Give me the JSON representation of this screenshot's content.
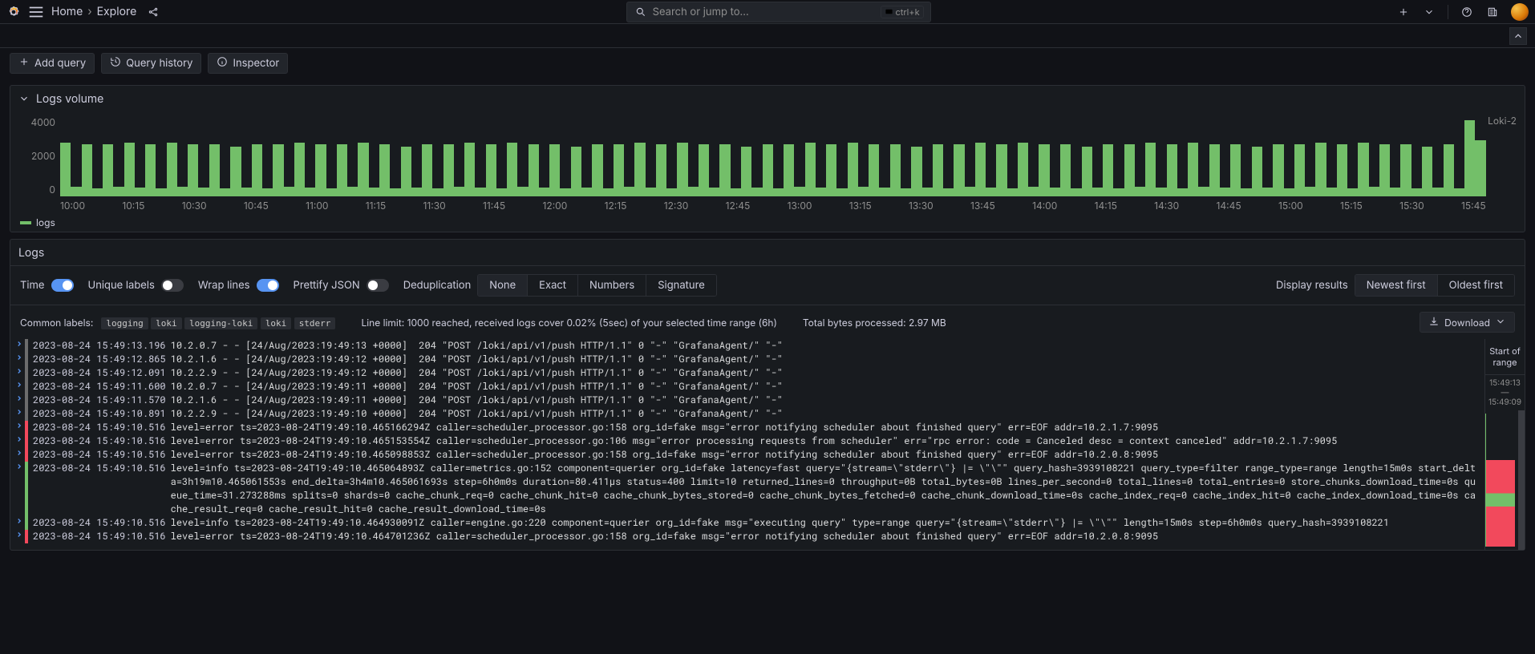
{
  "nav": {
    "home": "Home",
    "explore": "Explore",
    "search_placeholder": "Search or jump to...",
    "shortcut_hint": "ctrl+k"
  },
  "toolbar": {
    "add_query": "Add query",
    "query_history": "Query history",
    "inspector": "Inspector"
  },
  "logs_volume": {
    "title": "Logs volume",
    "legend_series": "Loki-2",
    "legend_label": "logs"
  },
  "logs_panel_title": "Logs",
  "controls": {
    "time_label": "Time",
    "unique_label": "Unique labels",
    "wrap_label": "Wrap lines",
    "prettify_label": "Prettify JSON",
    "dedup_label": "Deduplication",
    "dedup_options": [
      "None",
      "Exact",
      "Numbers",
      "Signature"
    ],
    "display_label": "Display results",
    "order_options": [
      "Newest first",
      "Oldest first"
    ]
  },
  "meta": {
    "common_labels_label": "Common labels:",
    "common_labels": [
      "logging",
      "loki",
      "logging-loki",
      "loki",
      "stderr"
    ],
    "line_limit": "Line limit: 1000 reached, received logs cover 0.02% (5sec) of your selected time range (6h)",
    "bytes": "Total bytes processed: 2.97 MB",
    "download": "Download"
  },
  "minimap": {
    "start": "Start of range",
    "t_top": "15:49:13",
    "t_mid": "—",
    "t_bot": "15:49:09"
  },
  "log_lines": [
    {
      "lvl": "none",
      "ts": "2023-08-24 15:49:13.196",
      "msg": "10.2.0.7 - - [24/Aug/2023:19:49:13 +0000]  204 \"POST /loki/api/v1/push HTTP/1.1\" 0 \"-\" \"GrafanaAgent/\" \"-\""
    },
    {
      "lvl": "none",
      "ts": "2023-08-24 15:49:12.865",
      "msg": "10.2.1.6 - - [24/Aug/2023:19:49:12 +0000]  204 \"POST /loki/api/v1/push HTTP/1.1\" 0 \"-\" \"GrafanaAgent/\" \"-\""
    },
    {
      "lvl": "none",
      "ts": "2023-08-24 15:49:12.091",
      "msg": "10.2.2.9 - - [24/Aug/2023:19:49:12 +0000]  204 \"POST /loki/api/v1/push HTTP/1.1\" 0 \"-\" \"GrafanaAgent/\" \"-\""
    },
    {
      "lvl": "none",
      "ts": "2023-08-24 15:49:11.600",
      "msg": "10.2.0.7 - - [24/Aug/2023:19:49:11 +0000]  204 \"POST /loki/api/v1/push HTTP/1.1\" 0 \"-\" \"GrafanaAgent/\" \"-\""
    },
    {
      "lvl": "none",
      "ts": "2023-08-24 15:49:11.570",
      "msg": "10.2.1.6 - - [24/Aug/2023:19:49:11 +0000]  204 \"POST /loki/api/v1/push HTTP/1.1\" 0 \"-\" \"GrafanaAgent/\" \"-\""
    },
    {
      "lvl": "none",
      "ts": "2023-08-24 15:49:10.891",
      "msg": "10.2.2.9 - - [24/Aug/2023:19:49:10 +0000]  204 \"POST /loki/api/v1/push HTTP/1.1\" 0 \"-\" \"GrafanaAgent/\" \"-\""
    },
    {
      "lvl": "error",
      "ts": "2023-08-24 15:49:10.516",
      "msg": "level=error ts=2023-08-24T19:49:10.465166294Z caller=scheduler_processor.go:158 org_id=fake msg=\"error notifying scheduler about finished query\" err=EOF addr=10.2.1.7:9095"
    },
    {
      "lvl": "error",
      "ts": "2023-08-24 15:49:10.516",
      "msg": "level=error ts=2023-08-24T19:49:10.465153554Z caller=scheduler_processor.go:106 msg=\"error processing requests from scheduler\" err=\"rpc error: code = Canceled desc = context canceled\" addr=10.2.1.7:9095"
    },
    {
      "lvl": "error",
      "ts": "2023-08-24 15:49:10.516",
      "msg": "level=error ts=2023-08-24T19:49:10.465098853Z caller=scheduler_processor.go:158 org_id=fake msg=\"error notifying scheduler about finished query\" err=EOF addr=10.2.0.8:9095"
    },
    {
      "lvl": "info",
      "ts": "2023-08-24 15:49:10.516",
      "msg": "level=info ts=2023-08-24T19:49:10.465064893Z caller=metrics.go:152 component=querier org_id=fake latency=fast query=\"{stream=\\\"stderr\\\"} |= \\\"\\\"\" query_hash=3939108221 query_type=filter range_type=range length=15m0s start_delta=3h19m10.465061553s end_delta=3h4m10.465061693s step=6h0m0s duration=80.411µs status=400 limit=10 returned_lines=0 throughput=0B total_bytes=0B lines_per_second=0 total_lines=0 total_entries=0 store_chunks_download_time=0s queue_time=31.273288ms splits=0 shards=0 cache_chunk_req=0 cache_chunk_hit=0 cache_chunk_bytes_stored=0 cache_chunk_bytes_fetched=0 cache_chunk_download_time=0s cache_index_req=0 cache_index_hit=0 cache_index_download_time=0s cache_result_req=0 cache_result_hit=0 cache_result_download_time=0s"
    },
    {
      "lvl": "info",
      "ts": "2023-08-24 15:49:10.516",
      "msg": "level=info ts=2023-08-24T19:49:10.464930091Z caller=engine.go:220 component=querier org_id=fake msg=\"executing query\" type=range query=\"{stream=\\\"stderr\\\"} |= \\\"\\\"\" length=15m0s step=6h0m0s query_hash=3939108221"
    },
    {
      "lvl": "error",
      "ts": "2023-08-24 15:49:10.516",
      "msg": "level=error ts=2023-08-24T19:49:10.464701236Z caller=scheduler_processor.go:158 org_id=fake msg=\"error notifying scheduler about finished query\" err=EOF addr=10.2.0.8:9095"
    }
  ],
  "chart_data": {
    "type": "bar",
    "title": "Logs volume",
    "ylabel": "",
    "ylim": [
      0,
      4000
    ],
    "y_ticks": [
      4000,
      2000,
      0
    ],
    "x_ticks": [
      "10:00",
      "10:15",
      "10:30",
      "10:45",
      "11:00",
      "11:15",
      "11:30",
      "11:45",
      "12:00",
      "12:15",
      "12:30",
      "12:45",
      "13:00",
      "13:15",
      "13:30",
      "13:45",
      "14:00",
      "14:15",
      "14:30",
      "14:45",
      "15:00",
      "15:15",
      "15:30",
      "15:45"
    ],
    "series": [
      {
        "name": "logs",
        "color": "#73bf69",
        "values": [
          2700,
          500,
          2600,
          400,
          2600,
          500,
          2700,
          450,
          2600,
          400,
          2700,
          500,
          2600,
          450,
          2600,
          400,
          2500,
          450,
          2600,
          400,
          2600,
          500,
          2700,
          450,
          2600,
          400,
          2600,
          500,
          2700,
          450,
          2600,
          400,
          2500,
          450,
          2600,
          400,
          2600,
          500,
          2700,
          450,
          2600,
          400,
          2700,
          500,
          2600,
          450,
          2600,
          400,
          2500,
          450,
          2600,
          400,
          2600,
          500,
          2700,
          450,
          2600,
          400,
          2700,
          500,
          2600,
          450,
          2600,
          400,
          2500,
          450,
          2600,
          400,
          2600,
          500,
          2700,
          450,
          2600,
          400,
          2700,
          500,
          2600,
          450,
          2600,
          400,
          2500,
          450,
          2600,
          400,
          2600,
          500,
          2700,
          450,
          2600,
          400,
          2700,
          500,
          2600,
          450,
          2600,
          400,
          2500,
          450,
          2600,
          400,
          2600,
          500,
          2700,
          450,
          2600,
          400,
          2700,
          500,
          2600,
          450,
          2600,
          400,
          2500,
          450,
          2600,
          400,
          2600,
          500,
          2700,
          450,
          2600,
          400,
          2700,
          500,
          2600,
          450,
          2600,
          400,
          2500,
          450,
          2600,
          400,
          3800,
          2800
        ]
      }
    ]
  }
}
